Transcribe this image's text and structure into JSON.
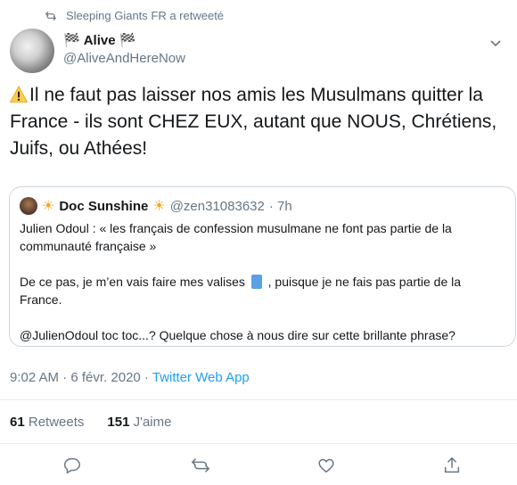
{
  "retweet": {
    "text": "Sleeping Giants FR a retweeté",
    "icon": "retweet-icon"
  },
  "author": {
    "name": "Alive",
    "handle": "@AliveAndHereNow"
  },
  "tweet": {
    "text": "Il ne faut pas laisser nos amis les Musulmans quitter la France - ils sont CHEZ EUX, autant que NOUS, Chrétiens, Juifs, ou Athées!"
  },
  "quote": {
    "name": "Doc Sunshine",
    "handle": "@zen31083632",
    "time": "· 7h",
    "para1": "Julien Odoul : « les français de confession musulmane ne font pas partie de la communauté française »",
    "para2a": "De ce pas, je m’en vais faire mes valises",
    "para2b": ", puisque je ne fais pas partie de la France.",
    "para3": "@JulienOdoul toc toc...? Quelque chose à nous dire sur cette brillante phrase?"
  },
  "meta": {
    "time": "9:02 AM · 6 févr. 2020 ·",
    "source": "Twitter Web App"
  },
  "stats": {
    "retweets_count": "61",
    "retweets_label": "Retweets",
    "likes_count": "151",
    "likes_label": "J'aime"
  },
  "colors": {
    "link": "#1da1f2",
    "muted": "#657786",
    "border": "#ccd6dd"
  }
}
